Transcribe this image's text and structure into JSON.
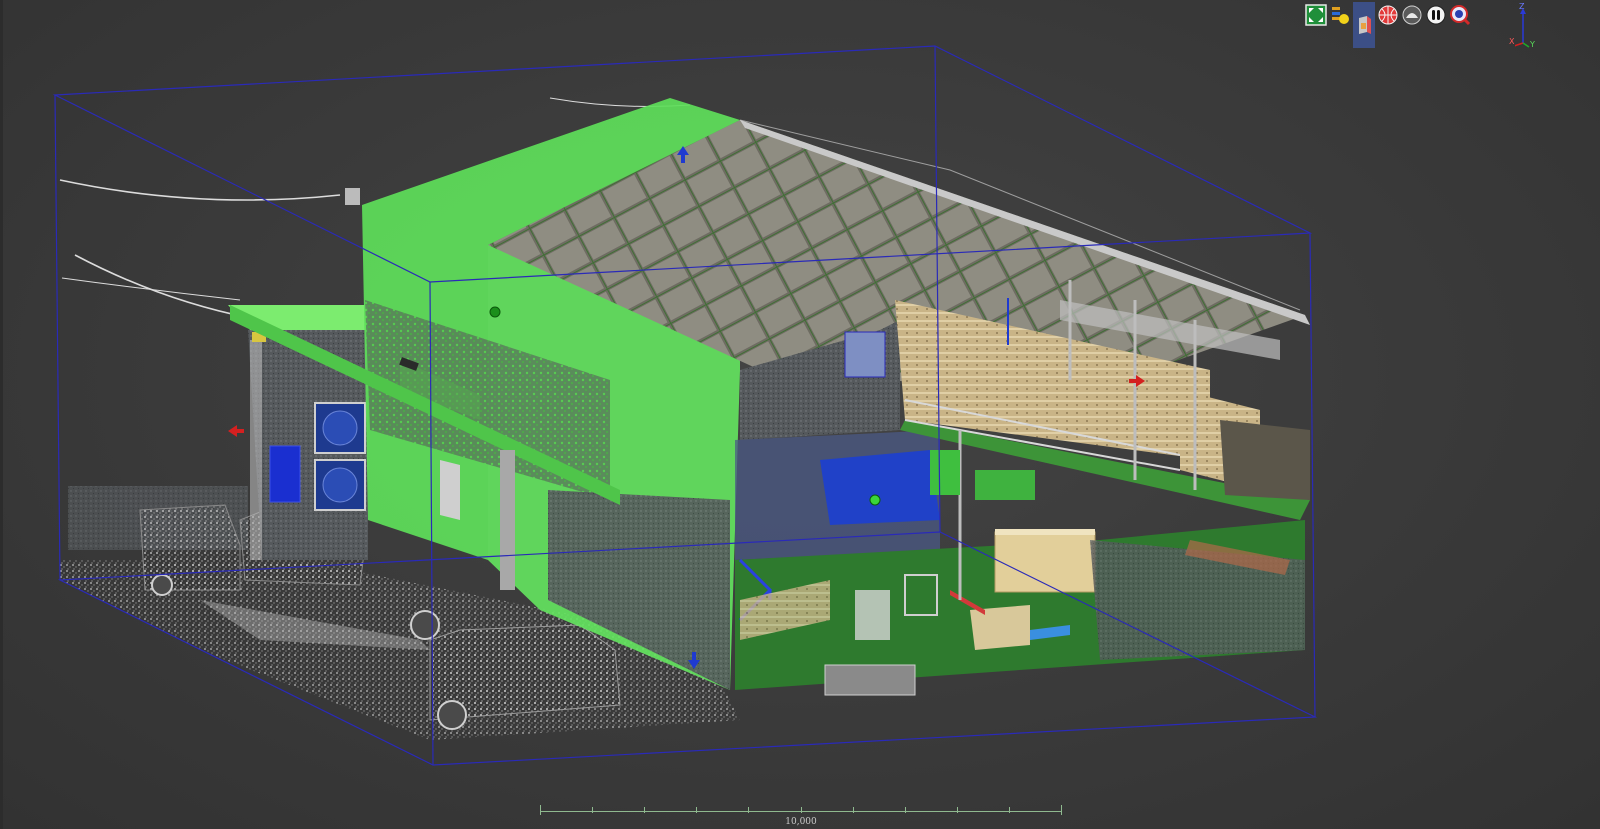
{
  "viewer": {
    "toolbar": [
      {
        "name": "fit-view",
        "icon": "zoom-extents-icon"
      },
      {
        "name": "show-layers",
        "icon": "layers-icon"
      },
      {
        "name": "clipping-box",
        "icon": "clipping-box-icon"
      },
      {
        "name": "globe-view",
        "icon": "globe-icon"
      },
      {
        "name": "helmet-mode",
        "icon": "helmet-icon"
      },
      {
        "name": "walk-mode",
        "icon": "walk-icon"
      },
      {
        "name": "inspect",
        "icon": "magnifier-icon"
      }
    ],
    "axes": {
      "x": "X",
      "y": "Y",
      "z": "Z"
    },
    "scale_bar": {
      "label": "10,000"
    }
  },
  "colors": {
    "background": "#3a3a3a",
    "clip_box": "#2a2ab8",
    "highlight_green": "#5ee05a",
    "floor_green": "#2e7a2e",
    "handle_red": "#d42020",
    "handle_blue": "#1f3ad0",
    "scale": "#8fb98f"
  }
}
